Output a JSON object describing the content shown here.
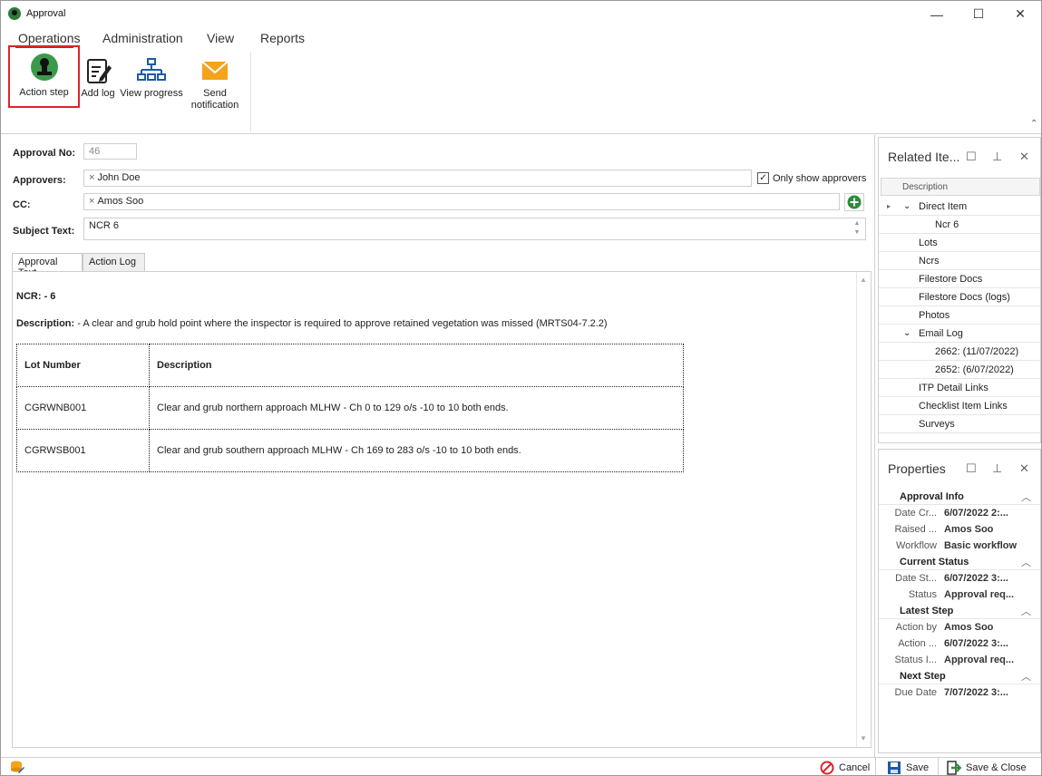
{
  "window": {
    "title": "Approval",
    "controls": [
      "minimize-icon",
      "maximize-icon",
      "close-icon"
    ]
  },
  "menu": {
    "tabs": [
      "Operations",
      "Administration",
      "View",
      "Reports"
    ],
    "active": "Operations"
  },
  "ribbon": {
    "buttons": [
      {
        "label": "Action step",
        "icon": "stamp-icon"
      },
      {
        "label": "Add log",
        "icon": "notepad-pencil-icon"
      },
      {
        "label": "View progress",
        "icon": "hierarchy-icon"
      },
      {
        "label_line1": "Send",
        "label_line2": "notification",
        "icon": "envelope-icon"
      }
    ]
  },
  "form": {
    "approval_no_label": "Approval No:",
    "approval_no": "46",
    "approvers_label": "Approvers:",
    "approver": "John  Doe",
    "only_show_approvers": "Only show approvers",
    "only_show_approvers_checked": true,
    "cc_label": "CC:",
    "cc": "Amos Soo",
    "subject_label": "Subject Text:",
    "subject": "NCR 6"
  },
  "tabs": [
    "Approval Text",
    "Action Log"
  ],
  "content": {
    "ncr_label": "NCR:",
    "ncr_value": "- 6",
    "description_label": "Description:",
    "description_value": "- A clear and grub hold point where the inspector is required to approve retained vegetation was missed (MRTS04-7.2.2)",
    "table": {
      "headers": [
        "Lot Number",
        "Description"
      ],
      "rows": [
        [
          "CGRWNB001",
          "Clear and grub northern approach MLHW - Ch 0 to 129 o/s -10 to 10 both ends."
        ],
        [
          "CGRWSB001",
          "Clear and grub southern approach MLHW - Ch 169 to 283 o/s -10 to 10 both ends."
        ]
      ]
    }
  },
  "related": {
    "title": "Related Ite...",
    "column": "Description",
    "items": [
      "Direct Item",
      "Ncr 6",
      "Lots",
      "Ncrs",
      "Filestore Docs",
      "Filestore Docs (logs)",
      "Photos",
      "Email Log",
      "2662: (11/07/2022)",
      "2652: (6/07/2022)",
      "ITP Detail Links",
      "Checklist Item Links",
      "Surveys"
    ]
  },
  "properties": {
    "title": "Properties",
    "groups": [
      {
        "name": "Approval Info",
        "rows": [
          [
            "Date Cr...",
            "6/07/2022 2:..."
          ],
          [
            "Raised ...",
            "Amos Soo"
          ],
          [
            "Workflow",
            "Basic workflow"
          ]
        ]
      },
      {
        "name": "Current Status",
        "rows": [
          [
            "Date St...",
            "6/07/2022 3:..."
          ],
          [
            "Status",
            "Approval req..."
          ]
        ]
      },
      {
        "name": "Latest Step",
        "rows": [
          [
            "Action by",
            "Amos Soo"
          ],
          [
            "Action ...",
            "6/07/2022 3:..."
          ],
          [
            "Status I...",
            "Approval req..."
          ]
        ]
      },
      {
        "name": "Next Step",
        "rows": [
          [
            "Due Date",
            "7/07/2022 3:..."
          ]
        ]
      }
    ]
  },
  "bottom": {
    "cancel": "Cancel",
    "save": "Save",
    "save_close": "Save & Close"
  },
  "colors": {
    "accent_blue": "#1e5aa8",
    "highlight_red": "#d9262c",
    "add_green": "#2e8b3a",
    "envelope_orange": "#f5a31a"
  }
}
